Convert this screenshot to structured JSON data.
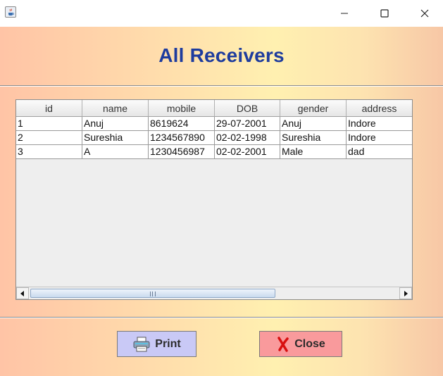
{
  "window": {
    "minimize_glyph": "—",
    "maximize_glyph": "☐",
    "close_glyph": "✕"
  },
  "heading": "All Receivers",
  "table": {
    "columns": [
      "id",
      "name",
      "mobile",
      "DOB",
      "gender",
      "address"
    ],
    "rows": [
      [
        "1",
        "Anuj",
        "8619624",
        "29-07-2001",
        "Anuj",
        "Indore"
      ],
      [
        "2",
        "Sureshia",
        "1234567890",
        "02-02-1998",
        "Sureshia",
        "Indore"
      ],
      [
        "3",
        "A",
        "1230456987",
        "02-02-2001",
        "Male",
        "dad"
      ]
    ]
  },
  "buttons": {
    "print_label": "Print",
    "print_icon": "printer-icon",
    "close_label": "Close",
    "close_icon": "red-x-icon"
  },
  "colors": {
    "heading": "#1e3c9e",
    "print_button_bg": "#c9c9f6",
    "close_button_bg": "#f99a9c"
  }
}
